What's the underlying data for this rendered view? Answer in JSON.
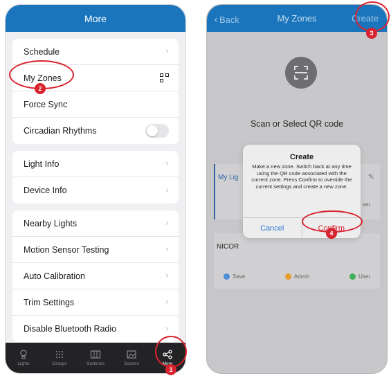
{
  "left": {
    "header_title": "More",
    "group1": [
      "Schedule",
      "My Zones",
      "Force Sync",
      "Circadian Rhythms"
    ],
    "group2": [
      "Light Info",
      "Device Info"
    ],
    "group3": [
      "Nearby Lights",
      "Motion Sensor Testing",
      "Auto Calibration",
      "Trim Settings",
      "Disable Bluetooth Radio"
    ],
    "tabs": [
      "Lights",
      "Groups",
      "Switches",
      "Scenes",
      "More"
    ]
  },
  "right": {
    "back_label": "Back",
    "header_title": "My Zones",
    "create_label": "Create",
    "scan_text": "Scan or Select QR code",
    "zone1_name": "My Lig",
    "zone1_user": "ser",
    "zone2_name": "NICOR",
    "actions": [
      "Save",
      "Admin",
      "User"
    ],
    "dialog": {
      "title": "Create",
      "message": "Make a new zone. Switch back at any time using the QR code associated with the current zone. Press Confirm to override the current settings and create a new zone.",
      "cancel": "Cancel",
      "confirm": "Confirm"
    }
  },
  "callouts": [
    "1",
    "2",
    "3",
    "4"
  ],
  "colors": {
    "header_blue": "#1b75bc",
    "callout_red": "#d9232e",
    "tabbar": "#232325"
  }
}
